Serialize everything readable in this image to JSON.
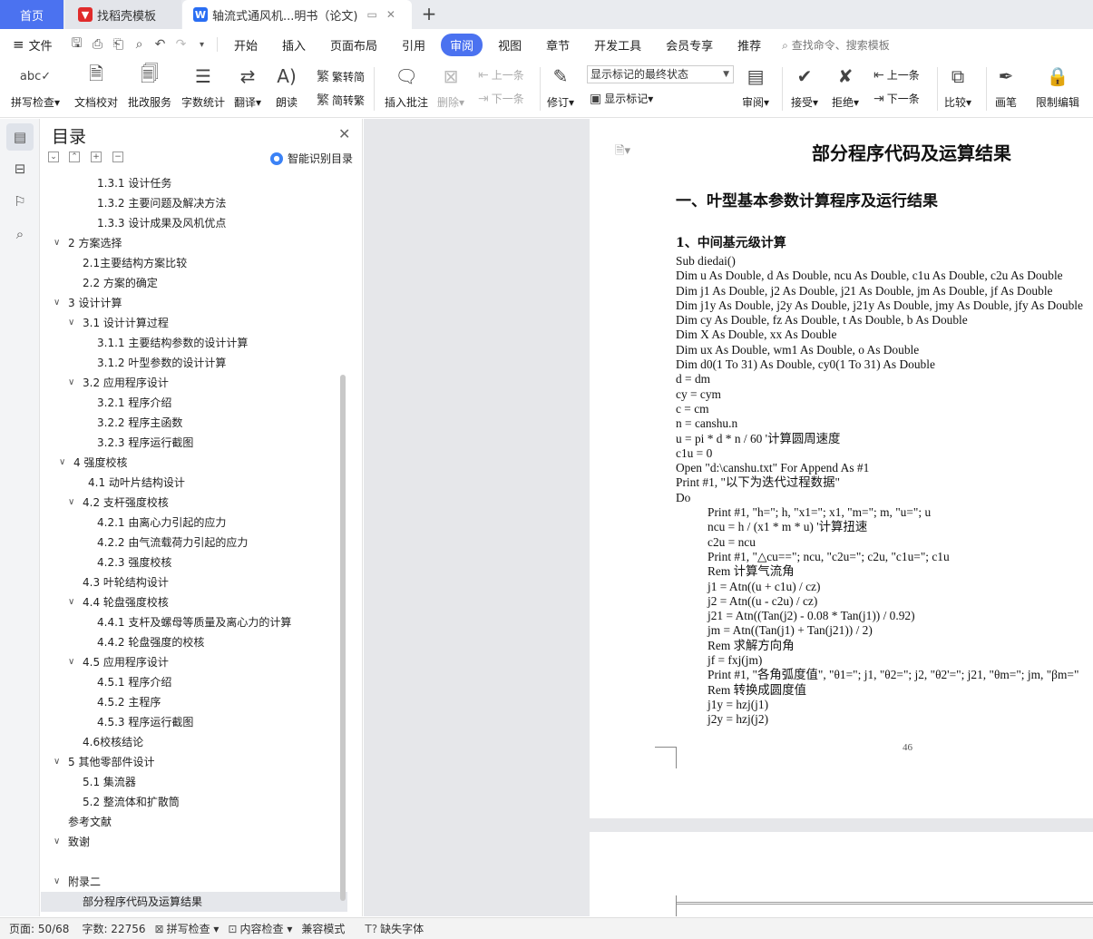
{
  "tabs": [
    {
      "label": "首页"
    },
    {
      "label": "找稻壳模板"
    },
    {
      "label": "轴流式通风机...明书（论文)"
    }
  ],
  "menu": {
    "file": "文件",
    "tabs": [
      "开始",
      "插入",
      "页面布局",
      "引用",
      "审阅",
      "视图",
      "章节",
      "开发工具",
      "会员专享",
      "推荐"
    ],
    "active_tab": "审阅",
    "search": "查找命令、搜索模板"
  },
  "ribbon": {
    "spell_check": "拼写检查",
    "doc_proof": "文档校对",
    "batch_service": "批改服务",
    "word_count": "字数统计",
    "translate": "翻译",
    "read_aloud": "朗读",
    "trad_to_simp": "繁转简",
    "simp_to_trad": "简转繁",
    "insert_comment": "插入批注",
    "delete": "删除",
    "prev": "上一条",
    "next": "下一条",
    "track_changes": "修订",
    "markup_state": "显示标记的最终状态",
    "show_markup": "显示标记",
    "review": "审阅",
    "accept": "接受",
    "reject": "拒绝",
    "prev2": "上一条",
    "next2": "下一条",
    "compare": "比较",
    "pen": "画笔",
    "restrict_edit": "限制编辑"
  },
  "toc": {
    "title": "目录",
    "smart": "智能识别目录",
    "items": [
      {
        "label": "1.3.1  设计任务",
        "level": 3,
        "chev": ""
      },
      {
        "label": "1.3.2  主要问题及解决方法",
        "level": 3,
        "chev": ""
      },
      {
        "label": "1.3.3  设计成果及风机优点",
        "level": 3,
        "chev": ""
      },
      {
        "label": "2  方案选择",
        "level": 1,
        "chev": "v"
      },
      {
        "label": "2.1主要结构方案比较",
        "level": 2,
        "chev": ""
      },
      {
        "label": "2.2  方案的确定",
        "level": 2,
        "chev": ""
      },
      {
        "label": "3  设计计算",
        "level": 1,
        "chev": "v"
      },
      {
        "label": "3.1  设计计算过程",
        "level": 2,
        "chev": "v"
      },
      {
        "label": "3.1.1  主要结构参数的设计计算",
        "level": 3,
        "chev": ""
      },
      {
        "label": "3.1.2  叶型参数的设计计算",
        "level": 3,
        "chev": ""
      },
      {
        "label": "3.2  应用程序设计",
        "level": 2,
        "chev": "v"
      },
      {
        "label": "3.2.1  程序介绍",
        "level": 3,
        "chev": ""
      },
      {
        "label": "3.2.2  程序主函数",
        "level": 3,
        "chev": ""
      },
      {
        "label": "3.2.3  程序运行截图",
        "level": 3,
        "chev": ""
      },
      {
        "label": "4  强度校核",
        "level": 1,
        "chev": "v",
        "pad": true
      },
      {
        "label": "4.1  动叶片结构设计",
        "level": 2,
        "chev": "",
        "pad": true
      },
      {
        "label": "4.2  支杆强度校核",
        "level": 2,
        "chev": "v"
      },
      {
        "label": "4.2.1  由离心力引起的应力",
        "level": 3,
        "chev": ""
      },
      {
        "label": "4.2.2  由气流载荷力引起的应力",
        "level": 3,
        "chev": ""
      },
      {
        "label": "4.2.3  强度校核",
        "level": 3,
        "chev": ""
      },
      {
        "label": "4.3  叶轮结构设计",
        "level": 2,
        "chev": ""
      },
      {
        "label": "4.4  轮盘强度校核",
        "level": 2,
        "chev": "v"
      },
      {
        "label": "4.4.1  支杆及螺母等质量及离心力的计算",
        "level": 3,
        "chev": ""
      },
      {
        "label": "4.4.2  轮盘强度的校核",
        "level": 3,
        "chev": ""
      },
      {
        "label": "4.5  应用程序设计",
        "level": 2,
        "chev": "v"
      },
      {
        "label": "4.5.1  程序介绍",
        "level": 3,
        "chev": ""
      },
      {
        "label": "4.5.2  主程序",
        "level": 3,
        "chev": ""
      },
      {
        "label": "4.5.3  程序运行截图",
        "level": 3,
        "chev": ""
      },
      {
        "label": "4.6校核结论",
        "level": 2,
        "chev": ""
      },
      {
        "label": "5  其他零部件设计",
        "level": 1,
        "chev": "v"
      },
      {
        "label": "5.1  集流器",
        "level": 2,
        "chev": ""
      },
      {
        "label": "5.2  整流体和扩散筒",
        "level": 2,
        "chev": ""
      },
      {
        "label": "参考文献",
        "level": 1,
        "chev": ""
      },
      {
        "label": "致谢",
        "level": 1,
        "chev": "v"
      },
      {
        "label": "",
        "level": 1,
        "chev": ""
      },
      {
        "label": "附录二",
        "level": 1,
        "chev": "v"
      },
      {
        "label": "部分程序代码及运算结果",
        "level": 2,
        "chev": "",
        "active": true
      }
    ]
  },
  "doc": {
    "title": "部分程序代码及运算结果",
    "h1": "一、叶型基本参数计算程序及运行结果",
    "h2": "1、中间基元级计算",
    "page_number": "46",
    "code": [
      {
        "t": "Sub diedai()",
        "i": 0
      },
      {
        "t": "Dim u As Double, d As Double, ncu As Double, c1u As Double, c2u As Double",
        "i": 0
      },
      {
        "t": "Dim j1 As Double, j2 As Double, j21 As Double, jm As Double, jf As Double",
        "i": 0
      },
      {
        "t": "Dim j1y As Double, j2y As Double, j21y As Double, jmy As Double, jfy As Double",
        "i": 0
      },
      {
        "t": "Dim cy As Double, fz As Double, t As Double, b As Double",
        "i": 0
      },
      {
        "t": "Dim X As Double, xx As Double",
        "i": 0
      },
      {
        "t": "Dim ux As Double, wm1 As Double, o As Double",
        "i": 0
      },
      {
        "t": "Dim d0(1 To 31) As Double, cy0(1 To 31) As Double",
        "i": 0
      },
      {
        "t": "d = dm",
        "i": 0
      },
      {
        "t": "cy = cym",
        "i": 0
      },
      {
        "t": "c = cm",
        "i": 0
      },
      {
        "t": "n = canshu.n",
        "i": 0
      },
      {
        "t": "u = pi * d * n / 60 '计算圆周速度",
        "i": 0
      },
      {
        "t": "c1u = 0",
        "i": 0
      },
      {
        "t": "Open \"d:\\canshu.txt\" For Append As #1",
        "i": 0
      },
      {
        "t": "Print #1, \"以下为迭代过程数据\"",
        "i": 0
      },
      {
        "t": "Do",
        "i": 0
      },
      {
        "t": "Print #1, \"h=\"; h, \"x1=\"; x1, \"m=\"; m, \"u=\"; u",
        "i": 1
      },
      {
        "t": "ncu = h / (x1 * m * u) '计算扭速",
        "i": 1
      },
      {
        "t": "c2u = ncu",
        "i": 1
      },
      {
        "t": "Print #1, \"△cu==\"; ncu, \"c2u=\"; c2u, \"c1u=\"; c1u",
        "i": 1
      },
      {
        "t": "Rem  计算气流角",
        "i": 1
      },
      {
        "t": "j1 = Atn((u + c1u) / cz)",
        "i": 1
      },
      {
        "t": "j2 = Atn((u - c2u) / cz)",
        "i": 1
      },
      {
        "t": "j21 = Atn((Tan(j2) - 0.08 * Tan(j1)) / 0.92)",
        "i": 1
      },
      {
        "t": "jm = Atn((Tan(j1) + Tan(j21)) / 2)",
        "i": 1
      },
      {
        "t": "Rem  求解方向角",
        "i": 1
      },
      {
        "t": "jf = fxj(jm)",
        "i": 1
      },
      {
        "t": "Print #1, \"各角弧度值\", \"θ1=\"; j1, \"θ2=\"; j2, \"θ2'=\"; j21, \"θm=\"; jm, \"βm=\"",
        "i": 1
      },
      {
        "t": "Rem  转换成圆度值",
        "i": 1
      },
      {
        "t": "j1y = hzj(j1)",
        "i": 1
      },
      {
        "t": "j2y = hzj(j2)",
        "i": 1
      }
    ]
  },
  "status": {
    "page": "页面: 50/68",
    "words": "字数: 22756",
    "spell": "拼写检查",
    "content_check": "内容检查",
    "compat": "兼容模式",
    "missing_font": "缺失字体"
  }
}
